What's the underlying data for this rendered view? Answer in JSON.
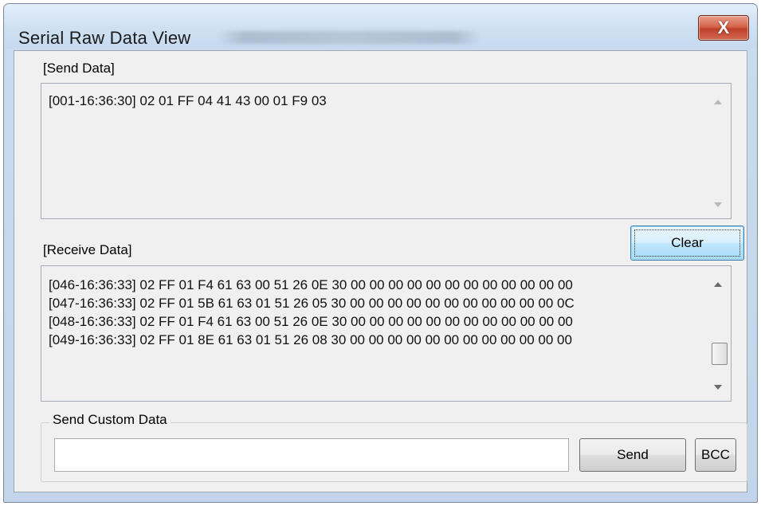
{
  "window": {
    "title": "Serial Raw Data View",
    "close_label": "X"
  },
  "send_section": {
    "label": "[Send Data]",
    "lines": [
      "[001-16:36:30] 02 01 FF 04 41 43 00 01 F9 03"
    ]
  },
  "receive_section": {
    "label": "[Receive Data]",
    "clear_label": "Clear",
    "lines": [
      "[046-16:36:33] 02 FF 01 F4 61 63 00 51 26 0E 30 00 00 00 00 00 00 00 00 00 00 00 00",
      "[047-16:36:33] 02 FF 01 5B 61 63 01 51 26 05 30 00 00 00 00 00 00 00 00 00 00 00 0C",
      "[048-16:36:33] 02 FF 01 F4 61 63 00 51 26 0E 30 00 00 00 00 00 00 00 00 00 00 00 00",
      "[049-16:36:33] 02 FF 01 8E 61 63 01 51 26 08 30 00 00 00 00 00 00 00 00 00 00 00 00"
    ]
  },
  "custom_section": {
    "label": "Send Custom Data",
    "input_value": "",
    "send_label": "Send",
    "bcc_label": "BCC"
  },
  "icons": {
    "close": "close-icon",
    "scroll_up": "scroll-up-arrow-icon",
    "scroll_down": "scroll-down-arrow-icon"
  }
}
